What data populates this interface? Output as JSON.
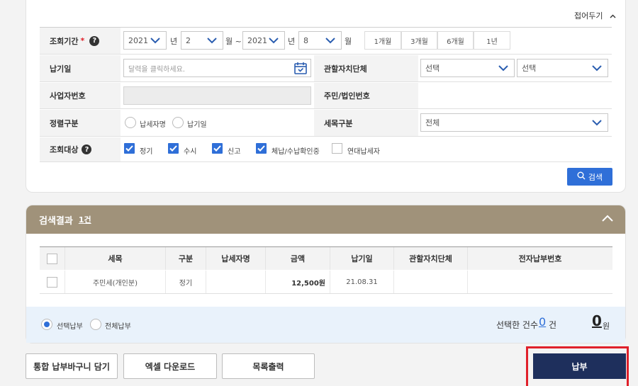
{
  "search_form": {
    "fold_label": "접어두기",
    "period": {
      "label": "조회기간",
      "required_mark": "*",
      "start_year": "2021",
      "year_unit": "년",
      "start_month": "2",
      "month_unit": "월",
      "tilde": "~",
      "end_year": "2021",
      "end_month": "8",
      "quick_buttons": [
        "1개월",
        "3개월",
        "6개월",
        "1년"
      ]
    },
    "due_date": {
      "label": "납기일",
      "placeholder": "달력을 클릭하세요."
    },
    "jurisdiction": {
      "label": "관할자치단체",
      "select1": "선택",
      "select2": "선택"
    },
    "business_no": {
      "label": "사업자번호"
    },
    "resident_no": {
      "label": "주민/법인번호"
    },
    "settlement": {
      "label": "정렬구분",
      "options": [
        "납세자명",
        "납기일"
      ]
    },
    "tax_item": {
      "label": "세목구분",
      "value": "전체"
    },
    "target": {
      "label": "조회대상",
      "options": [
        {
          "label": "정기",
          "checked": true
        },
        {
          "label": "수시",
          "checked": true
        },
        {
          "label": "신고",
          "checked": true
        },
        {
          "label": "체납/수납확인중",
          "checked": true
        },
        {
          "label": "연대납세자",
          "checked": false
        }
      ]
    },
    "search_button": "검색"
  },
  "results": {
    "title": "검색결과",
    "count": "1건",
    "columns": [
      "세목",
      "구분",
      "납세자명",
      "금액",
      "납기일",
      "관할자치단체",
      "전자납부번호"
    ],
    "rows": [
      {
        "item": "주민세(개인분)",
        "type": "정기",
        "name": "",
        "amount": "12,500원",
        "due": "21.08.31",
        "jurisdiction": "",
        "epay_no": ""
      }
    ],
    "pay_mode": [
      "선택납부",
      "전체납부"
    ],
    "selected_count_label": "선택한 건수",
    "selected_count": "0",
    "count_unit": "건",
    "total_amount": "0",
    "amount_unit": "원"
  },
  "footer": {
    "buttons": [
      "통합 납부바구니 담기",
      "엑셀 다운로드",
      "목록출력"
    ],
    "pay_button": "납부"
  },
  "colors": {
    "accent": "#2f6fd8",
    "result_header": "#a0927a",
    "pay_button": "#1e2f5c",
    "highlight": "#e0202a"
  }
}
